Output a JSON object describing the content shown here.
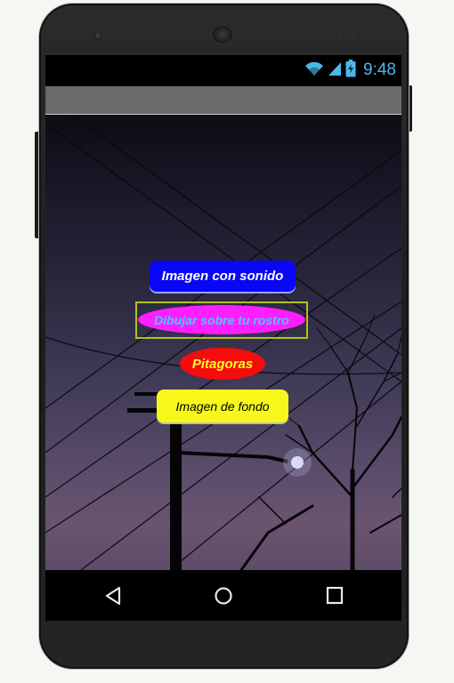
{
  "status_bar": {
    "time": "9:48",
    "icons": [
      "wifi-icon",
      "signal-icon",
      "battery-icon"
    ],
    "accent_color": "#4ab8e6"
  },
  "title_bar": {
    "title": ""
  },
  "buttons": [
    {
      "label": "Imagen con sonido",
      "bg": "#0a06f6",
      "text_color": "#ffffff"
    },
    {
      "label": "Dibujar sobre tu rostro",
      "bg": "#ff1eff",
      "text_color": "#44c9ff"
    },
    {
      "label": "Pitagoras",
      "bg": "#f50c0c",
      "text_color": "#ffff22"
    },
    {
      "label": "Imagen de fondo",
      "bg": "#f7f71b",
      "text_color": "#000000"
    }
  ],
  "nav_bar": {
    "icons": [
      "back-icon",
      "home-icon",
      "recents-icon"
    ]
  }
}
